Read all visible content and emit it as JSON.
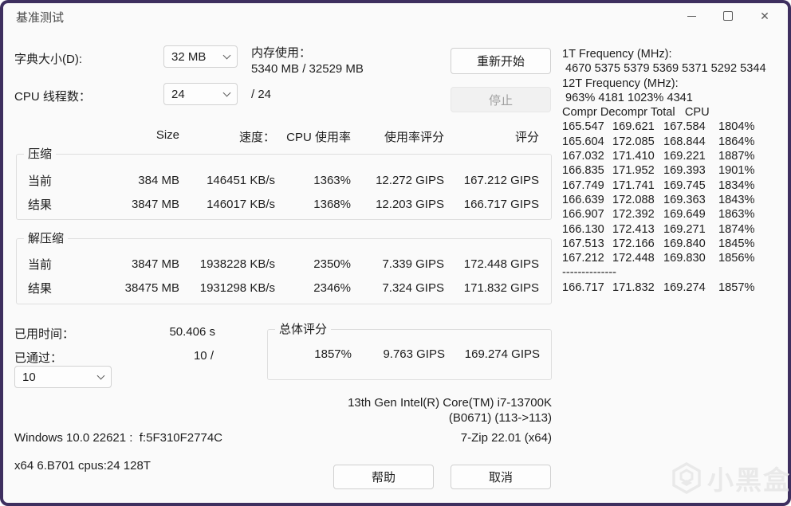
{
  "window": {
    "title": "基准测试",
    "controls": {
      "close_icon": "✕"
    }
  },
  "settings": {
    "dictionary_label": "字典大小(D):",
    "dictionary_value": "32 MB",
    "memory_label": "内存使用：",
    "memory_value": "5340 MB / 32529 MB",
    "threads_label": "CPU 线程数：",
    "threads_value": "24",
    "threads_total": "/ 24"
  },
  "actions": {
    "restart": "重新开始",
    "stop": "停止"
  },
  "freq_panel": {
    "lines": [
      "1T Frequency (MHz):",
      " 4670 5375 5379 5369 5371 5292 5344",
      "12T Frequency (MHz):",
      " 963% 4181 1023% 4341",
      "Compr Decompr Total   CPU"
    ],
    "rows": [
      [
        "165.547",
        "169.621",
        "167.584",
        "1804%"
      ],
      [
        "165.604",
        "172.085",
        "168.844",
        "1864%"
      ],
      [
        "167.032",
        "171.410",
        "169.221",
        "1887%"
      ],
      [
        "166.835",
        "171.952",
        "169.393",
        "1901%"
      ],
      [
        "167.749",
        "171.741",
        "169.745",
        "1834%"
      ],
      [
        "166.639",
        "172.088",
        "169.363",
        "1843%"
      ],
      [
        "166.907",
        "172.392",
        "169.649",
        "1863%"
      ],
      [
        "166.130",
        "172.413",
        "169.271",
        "1874%"
      ],
      [
        "167.513",
        "172.166",
        "169.840",
        "1845%"
      ],
      [
        "167.212",
        "172.448",
        "169.830",
        "1856%"
      ]
    ],
    "separator": "--------------",
    "total": [
      "166.717",
      "171.832",
      "169.274",
      "1857%"
    ]
  },
  "results": {
    "headers": {
      "size": "Size",
      "speed": "速度：",
      "cpu": "CPU 使用率",
      "usage_rating": "使用率评分",
      "rating": "评分"
    },
    "compression": {
      "title": "压缩",
      "rows": [
        {
          "label": "当前",
          "size": "384 MB",
          "speed": "146451 KB/s",
          "cpu": "1363%",
          "usage": "12.272 GIPS",
          "rating": "167.212 GIPS"
        },
        {
          "label": "结果",
          "size": "3847 MB",
          "speed": "146017 KB/s",
          "cpu": "1368%",
          "usage": "12.203 GIPS",
          "rating": "166.717 GIPS"
        }
      ]
    },
    "decompression": {
      "title": "解压缩",
      "rows": [
        {
          "label": "当前",
          "size": "3847 MB",
          "speed": "1938228 KB/s",
          "cpu": "2350%",
          "usage": "7.339 GIPS",
          "rating": "172.448 GIPS"
        },
        {
          "label": "结果",
          "size": "38475 MB",
          "speed": "1931298 KB/s",
          "cpu": "2346%",
          "usage": "7.324 GIPS",
          "rating": "171.832 GIPS"
        }
      ]
    }
  },
  "summary": {
    "elapsed_label": "已用时间：",
    "elapsed_value": "50.406 s",
    "passes_label": "已通过：",
    "passes_value": "10 /",
    "passes_dropdown": "10",
    "total_title": "总体评分",
    "total_cpu": "1857%",
    "total_usage": "9.763 GIPS",
    "total_rating": "169.274 GIPS"
  },
  "footer": {
    "cpu_name": "13th Gen Intel(R) Core(TM) i7-13700K",
    "cpu_detail": "(B0671) (113->113)",
    "os": "Windows 10.0 22621 :  f:5F310F2774C",
    "app_version": "7-Zip 22.01 (x64)",
    "build": "x64 6.B701 cpus:24 128T",
    "help": "帮助",
    "cancel": "取消"
  },
  "watermark": {
    "text": "小黑盒"
  }
}
